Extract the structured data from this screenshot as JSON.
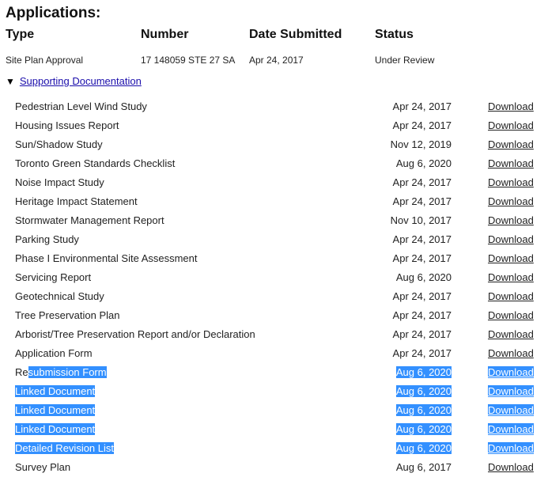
{
  "heading": "Applications:",
  "columns": [
    "Type",
    "Number",
    "Date Submitted",
    "Status"
  ],
  "application": {
    "type": "Site Plan Approval",
    "number": "17 148059 STE 27 SA",
    "date": "Apr 24, 2017",
    "status": "Under Review"
  },
  "toggle": {
    "icon": "▼",
    "label": "Supporting Documentation"
  },
  "download_label": "Download",
  "documents": [
    {
      "name": "Pedestrian Level Wind Study",
      "date": "Apr 24, 2017"
    },
    {
      "name": "Housing Issues Report",
      "date": "Apr 24, 2017"
    },
    {
      "name": "Sun/Shadow Study",
      "date": "Nov 12, 2019"
    },
    {
      "name": "Toronto Green Standards Checklist",
      "date": "Aug 6, 2020"
    },
    {
      "name": "Noise Impact Study",
      "date": "Apr 24, 2017"
    },
    {
      "name": "Heritage Impact Statement",
      "date": "Apr 24, 2017"
    },
    {
      "name": "Stormwater Management Report",
      "date": "Nov 10, 2017"
    },
    {
      "name": "Parking Study",
      "date": "Apr 24, 2017"
    },
    {
      "name": "Phase I Environmental Site Assessment",
      "date": "Apr 24, 2017"
    },
    {
      "name": "Servicing Report",
      "date": "Aug 6, 2020"
    },
    {
      "name": "Geotechnical Study",
      "date": "Apr 24, 2017"
    },
    {
      "name": "Tree Preservation Plan",
      "date": "Apr 24, 2017"
    },
    {
      "name": "Arborist/Tree Preservation Report and/or Declaration",
      "date": "Apr 24, 2017"
    },
    {
      "name": "Application Form",
      "date": "Apr 24, 2017"
    },
    {
      "name": "Resubmission Form",
      "date": "Aug 6, 2020",
      "selection": "partial",
      "unselected_prefix": "Re",
      "selected_rest": "submission Form"
    },
    {
      "name": "Linked Document",
      "date": "Aug 6, 2020",
      "selection": "full"
    },
    {
      "name": "Linked Document",
      "date": "Aug 6, 2020",
      "selection": "full"
    },
    {
      "name": "Linked Document",
      "date": "Aug 6, 2020",
      "selection": "full"
    },
    {
      "name": "Detailed Revision List",
      "date": "Aug 6, 2020",
      "selection": "full"
    },
    {
      "name": "Survey Plan",
      "date": "Aug 6, 2017",
      "selection": "none"
    }
  ]
}
